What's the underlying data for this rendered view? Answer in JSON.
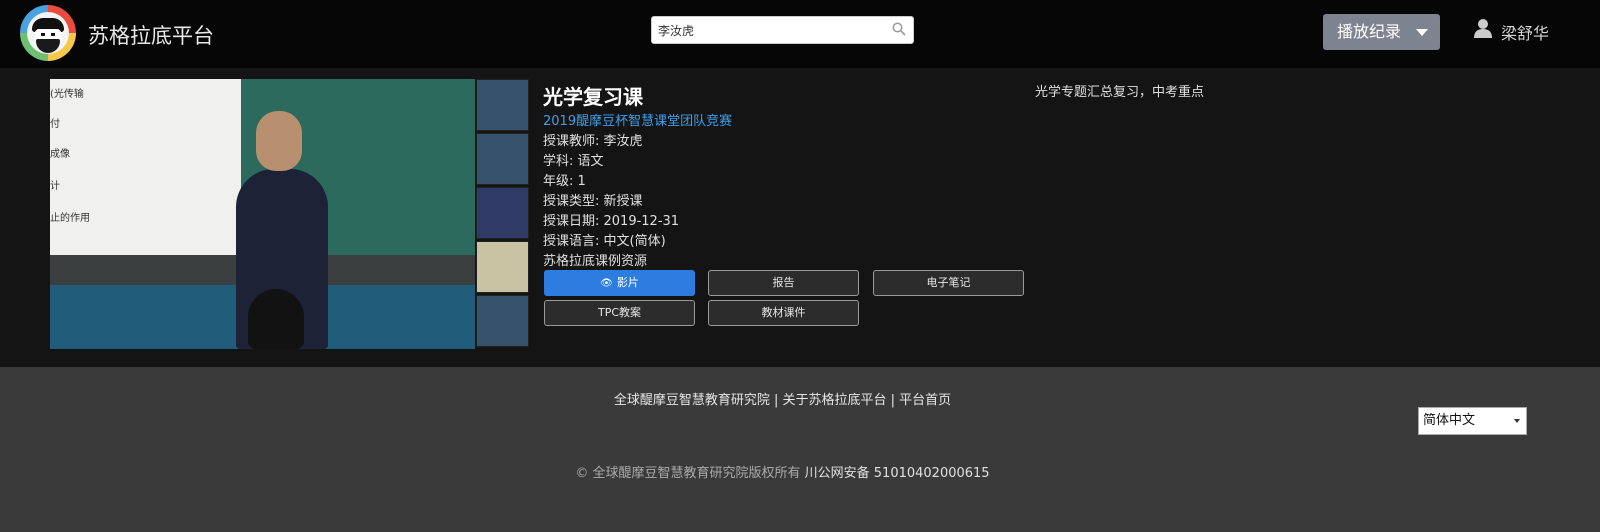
{
  "header": {
    "brand": "苏格拉底平台",
    "search_value": "李汝虎",
    "play_log_label": "播放纪录",
    "user_name": "梁舒华"
  },
  "video": {
    "board_text": [
      "(光传输",
      "付",
      "成像",
      "计",
      "止的作用"
    ]
  },
  "lesson": {
    "title": "光学复习课",
    "competition": "2019醍摩豆杯智慧课堂团队竞赛",
    "teacher": "授课教师: 李汝虎",
    "subject": "学科: 语文",
    "grade": "年级: 1",
    "type": "授课类型: 新授课",
    "date": "授课日期: 2019-12-31",
    "language": "授课语言: 中文(简体)",
    "source": "苏格拉底课例资源",
    "description": "光学专题汇总复习，中考重点"
  },
  "buttons": {
    "film": "影片",
    "report": "报告",
    "notes": "电子笔记",
    "tpc": "TPC教案",
    "materials": "教材课件"
  },
  "footer": {
    "link1": "全球醍摩豆智慧教育研究院",
    "sep": " | ",
    "link2": "关于苏格拉底平台",
    "link3": "平台首页",
    "language": "简体中文",
    "copyright": "© 全球醍摩豆智慧教育研究院版权所有 ",
    "police_record": "川公网安备 51010402000615"
  }
}
